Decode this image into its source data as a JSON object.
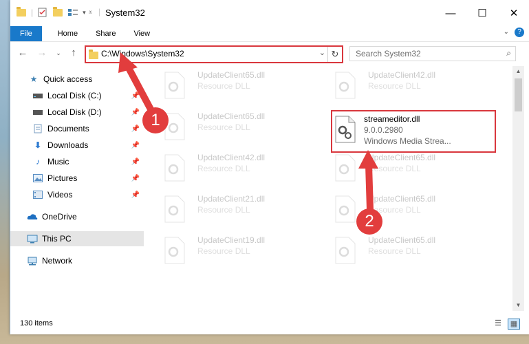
{
  "window": {
    "title": "System32"
  },
  "ribbon": {
    "tabs": [
      "File",
      "Home",
      "Share",
      "View"
    ]
  },
  "address": {
    "path": "C:\\Windows\\System32"
  },
  "search": {
    "placeholder": "Search System32"
  },
  "sidebar": {
    "items": [
      {
        "label": "Quick access",
        "icon": "star-icon"
      },
      {
        "label": "Local Disk (C:)",
        "icon": "drive-icon"
      },
      {
        "label": "Local Disk (D:)",
        "icon": "drive-icon"
      },
      {
        "label": "Documents",
        "icon": "documents-icon"
      },
      {
        "label": "Downloads",
        "icon": "download-icon"
      },
      {
        "label": "Music",
        "icon": "music-icon"
      },
      {
        "label": "Pictures",
        "icon": "pictures-icon"
      },
      {
        "label": "Videos",
        "icon": "videos-icon"
      },
      {
        "label": "OneDrive",
        "icon": "cloud-icon"
      },
      {
        "label": "This PC",
        "icon": "computer-icon"
      },
      {
        "label": "Network",
        "icon": "network-icon"
      }
    ]
  },
  "files": {
    "ghost_left": [
      {
        "name": "UpdateClient65.dll",
        "type": "Resource DLL"
      },
      {
        "name": "UpdateClient65.dll",
        "type": "Resource DLL"
      },
      {
        "name": "UpdateClient42.dll",
        "type": "Resource DLL"
      },
      {
        "name": "UpdateClient21.dll",
        "type": "Resource DLL"
      },
      {
        "name": "UpdateClient19.dll",
        "type": "Resource DLL"
      }
    ],
    "ghost_right": [
      {
        "name": "UpdateClient42.dll",
        "type": "Resource DLL"
      },
      {
        "name": "UpdateClient65.dll",
        "type": "Resource DLL"
      },
      {
        "name": "UpdateClient65.dll",
        "type": "Resource DLL"
      },
      {
        "name": "UpdateClient65.dll",
        "type": "Resource DLL"
      }
    ],
    "highlighted": {
      "name": "streameditor.dll",
      "version": "9.0.0.2980",
      "description": "Windows Media Strea..."
    }
  },
  "status": {
    "items": "130 items"
  },
  "callouts": [
    "1",
    "2"
  ],
  "colors": {
    "accent": "#1979ca",
    "highlight": "#d9373d"
  }
}
